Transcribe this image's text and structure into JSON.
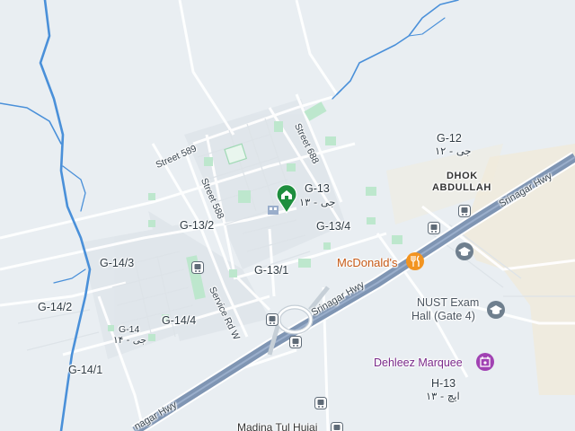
{
  "map": {
    "sectors": {
      "g12": "G-12",
      "g12_urdu": "جی - ۱۲",
      "g13": "G-13",
      "g13_urdu": "جی - ۱۳",
      "g13_2": "G-13/2",
      "g13_4": "G-13/4",
      "g13_1": "G-13/1",
      "g14": "G-14",
      "g14_urdu": "جی - ۱۴",
      "g14_3": "G-14/3",
      "g14_2": "G-14/2",
      "g14_4": "G-14/4",
      "g14_1": "G-14/1",
      "h13": "H-13",
      "h13_urdu": "ایچ - ۱۳"
    },
    "roads": {
      "street_589": "Street 589",
      "street_588": "Street 588",
      "street_688": "Street 688",
      "service_rd_w": "Service Rd W",
      "srinagar_hwy_1": "Srinagar Hwy",
      "srinagar_hwy_2": "Srinagar Hwy",
      "srinagar_hwy_3": "nagar Hwy"
    },
    "places": {
      "dhok_line1": "DHOK",
      "dhok_line2": "ABDULLAH",
      "mcdonalds": "McDonald's",
      "nust_line1": "NUST Exam",
      "nust_line2": "Hall (Gate 4)",
      "dehleez": "Dehleez Marquee",
      "madina": "Madina Tul Hujaj"
    },
    "colors": {
      "background": "#e9eef2",
      "water": "#4a90d9",
      "highway": "#7f95b3",
      "park": "#bfe8cf",
      "sand": "#efe9d7",
      "pin": "#1e8e3e",
      "food": "#f29421",
      "education": "#6f7f8e",
      "event_venue": "#a142b3",
      "transit": "#5f6b77"
    },
    "icons": [
      "home-pin-icon",
      "fork-knife-icon",
      "graduation-cap-icon",
      "calendar-star-icon",
      "bus-stop-icon"
    ]
  }
}
